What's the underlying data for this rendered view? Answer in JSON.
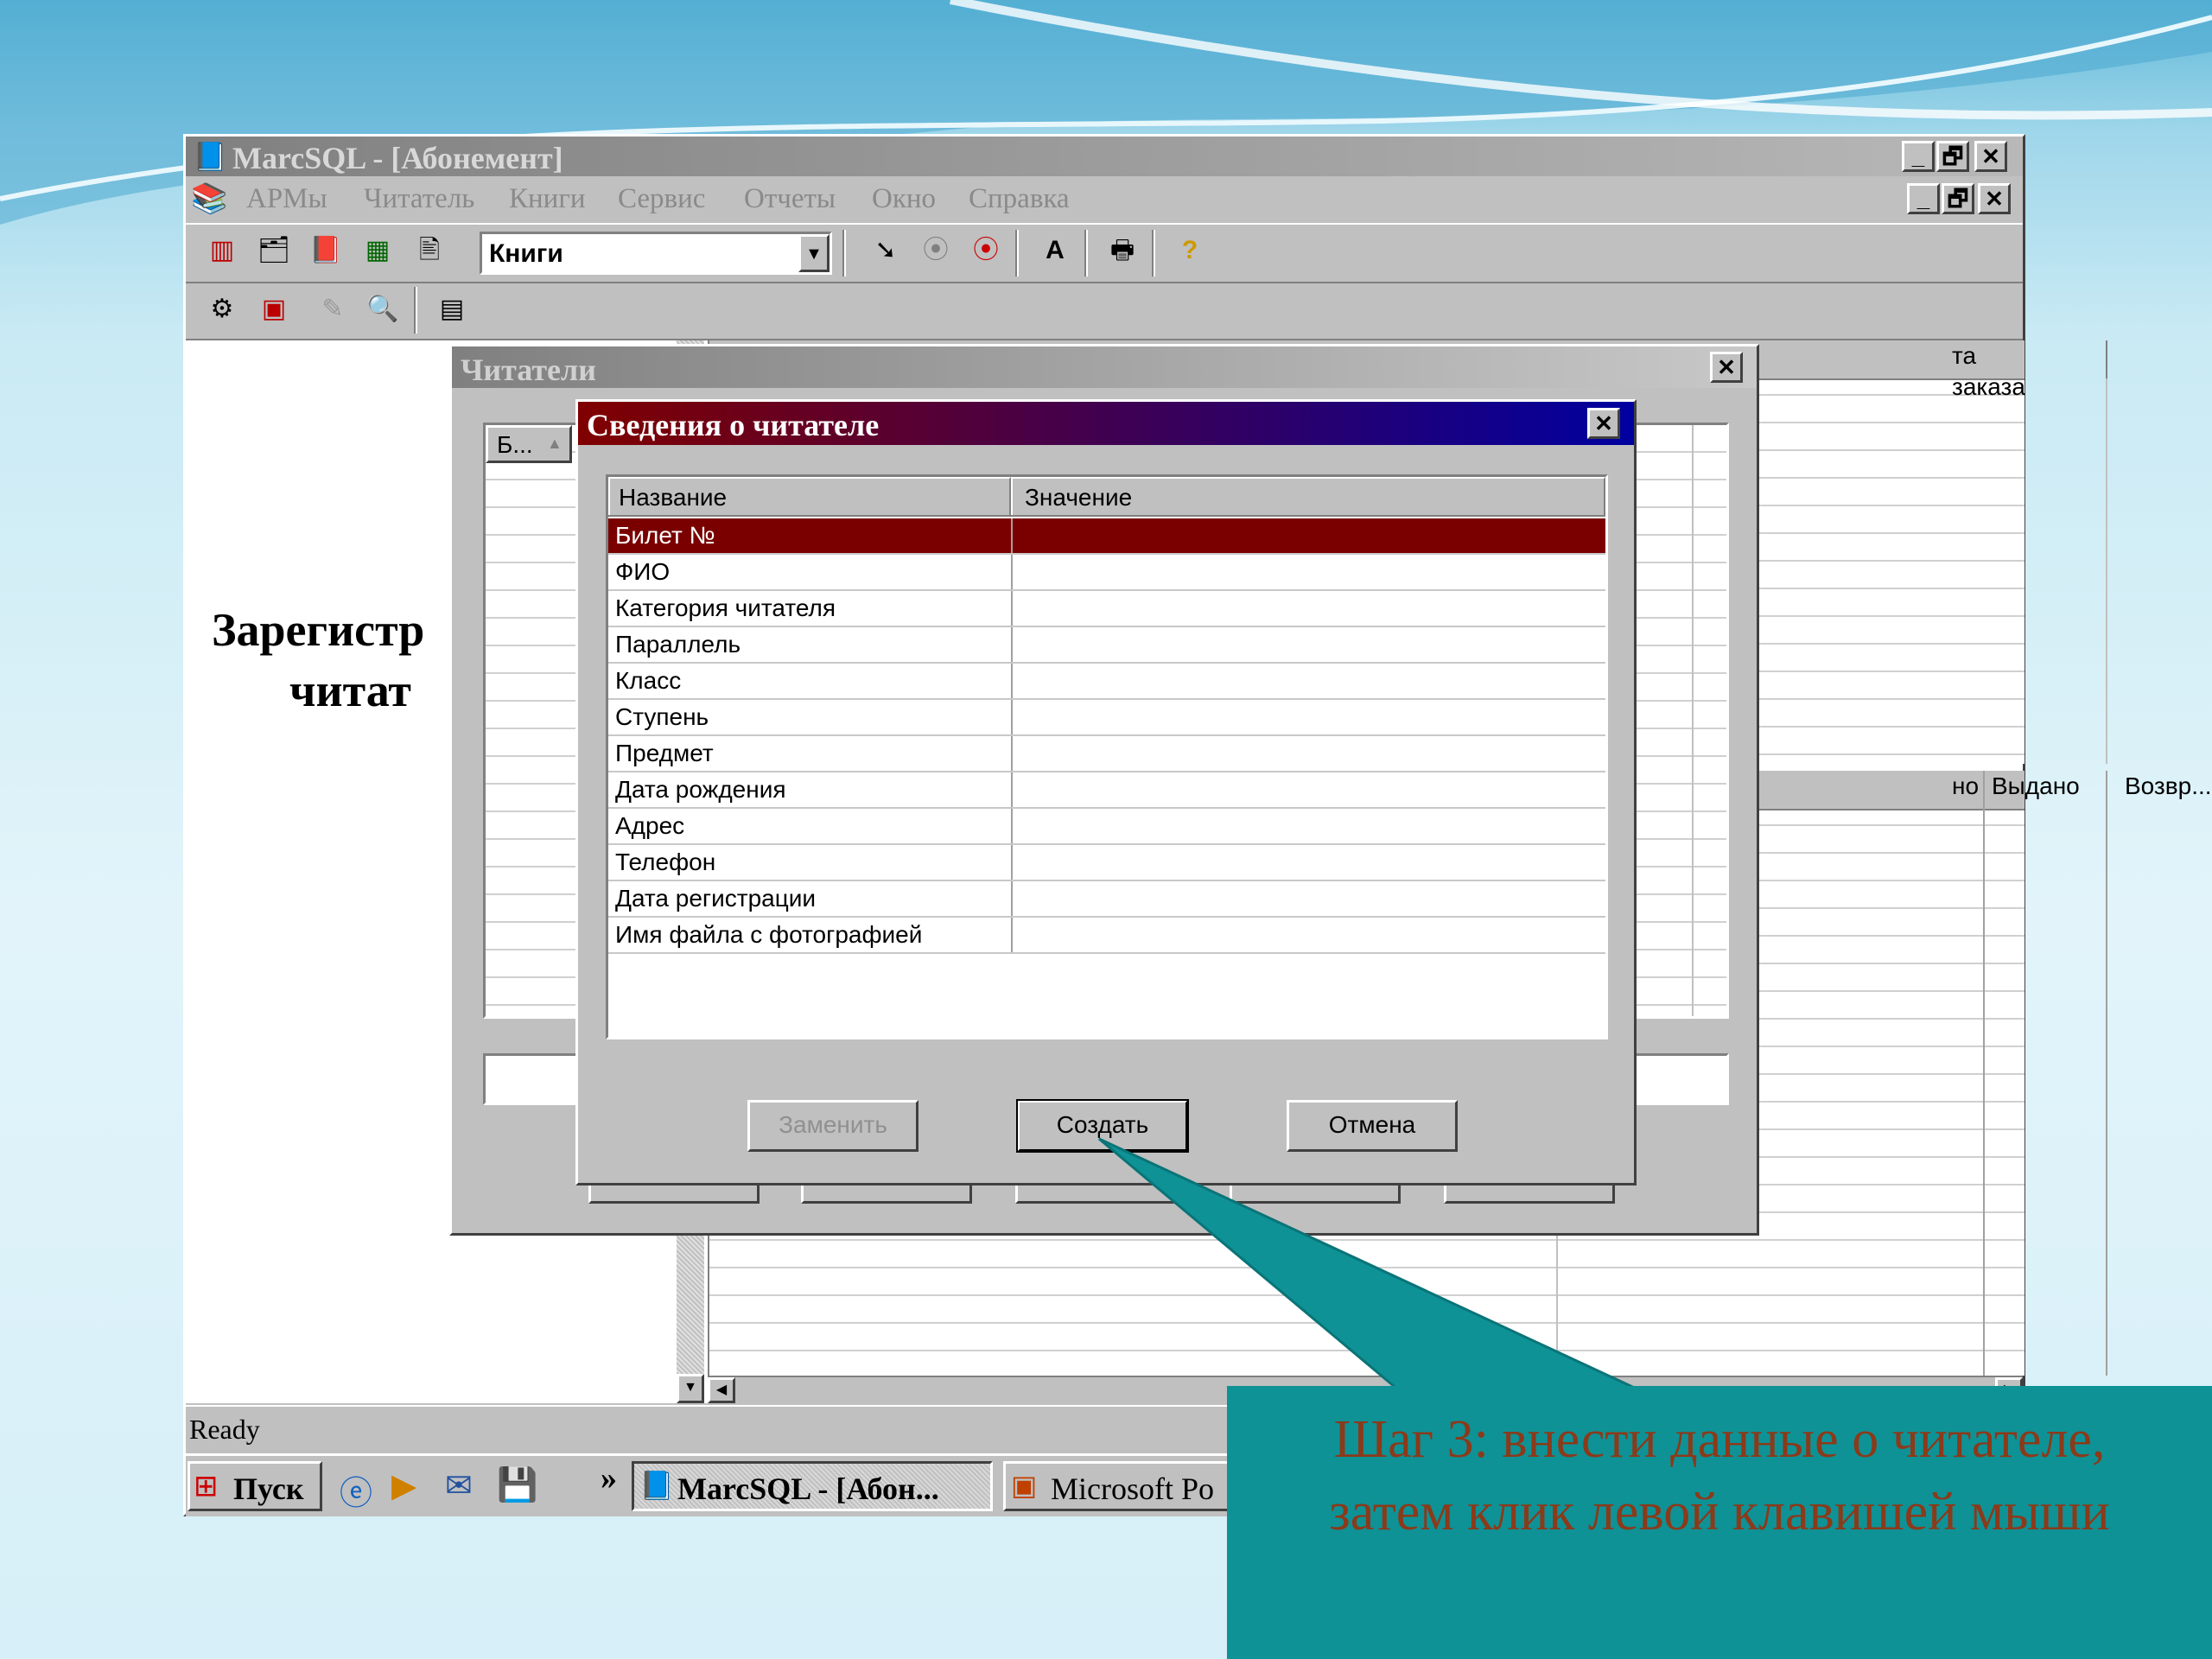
{
  "app": {
    "title": "MarcSQL - [Абонемент]",
    "menu": [
      "АРМы",
      "Читатель",
      "Книги",
      "Сервис",
      "Отчеты",
      "Окно",
      "Справка"
    ],
    "toolbar_select_value": "Книги",
    "status": "Ready"
  },
  "background_window": {
    "left_text_line1": "Зарегистр",
    "left_text_line2": "читат",
    "right_headers_top": "та заказа",
    "right_headers_bottom": [
      "но",
      "Выдано",
      "Возвр..."
    ]
  },
  "readers_window": {
    "title": "Читатели",
    "list_col": "Б...",
    "sort_glyph": "▲"
  },
  "dialog": {
    "title": "Сведения о читателе",
    "col_name": "Название",
    "col_value": "Значение",
    "fields": [
      {
        "name": "Билет №",
        "value": ""
      },
      {
        "name": "ФИО",
        "value": ""
      },
      {
        "name": "Категория читателя",
        "value": ""
      },
      {
        "name": "Параллель",
        "value": ""
      },
      {
        "name": "Класс",
        "value": ""
      },
      {
        "name": "Ступень",
        "value": ""
      },
      {
        "name": "Предмет",
        "value": ""
      },
      {
        "name": "Дата рождения",
        "value": ""
      },
      {
        "name": "Адрес",
        "value": ""
      },
      {
        "name": "Телефон",
        "value": ""
      },
      {
        "name": "Дата регистрации",
        "value": ""
      },
      {
        "name": "Имя файла с фотографией",
        "value": ""
      }
    ],
    "buttons": {
      "replace": "Заменить",
      "create": "Создать",
      "cancel": "Отмена"
    }
  },
  "taskbar": {
    "start": "Пуск",
    "chevron": "»",
    "task1": "MarcSQL - [Абон...",
    "task2": "Microsoft Po"
  },
  "callout": {
    "text": "Шаг 3: внести данные  о читателе, затем клик левой клавишей мыши"
  },
  "colors": {
    "dialog_title_start": "#800000",
    "dialog_title_end": "#0000a0",
    "selected_row": "#7a0000",
    "callout_bg": "#0e9296",
    "callout_text": "#8b3a1a"
  }
}
